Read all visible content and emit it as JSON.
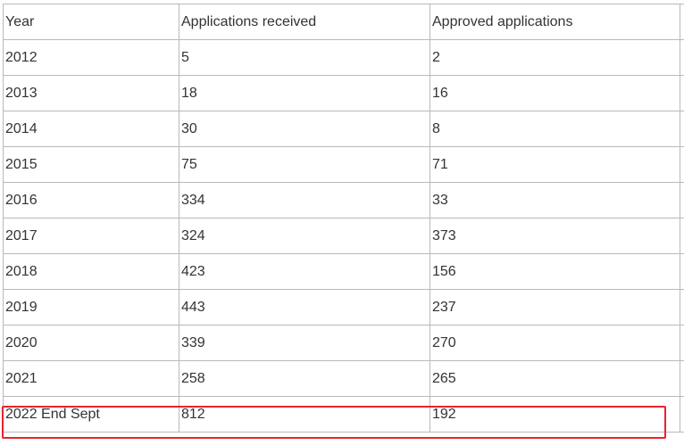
{
  "table": {
    "headers": [
      "Year",
      "Applications received",
      "Approved applications"
    ],
    "rows": [
      [
        "2012",
        "5",
        "2"
      ],
      [
        "2013",
        "18",
        "16"
      ],
      [
        "2014",
        "30",
        "8"
      ],
      [
        "2015",
        "75",
        "71"
      ],
      [
        "2016",
        "334",
        "33"
      ],
      [
        "2017",
        "324",
        "373"
      ],
      [
        "2018",
        "423",
        "156"
      ],
      [
        "2019",
        "443",
        "237"
      ],
      [
        "2020",
        "339",
        "270"
      ],
      [
        "2021",
        "258",
        "265"
      ],
      [
        "2022 End Sept",
        "812",
        "192"
      ]
    ]
  },
  "highlight": {
    "row": "2022 End Sept",
    "color": "#e8242a"
  },
  "colors": {
    "border": "#b9b9b9",
    "text": "#333333"
  }
}
